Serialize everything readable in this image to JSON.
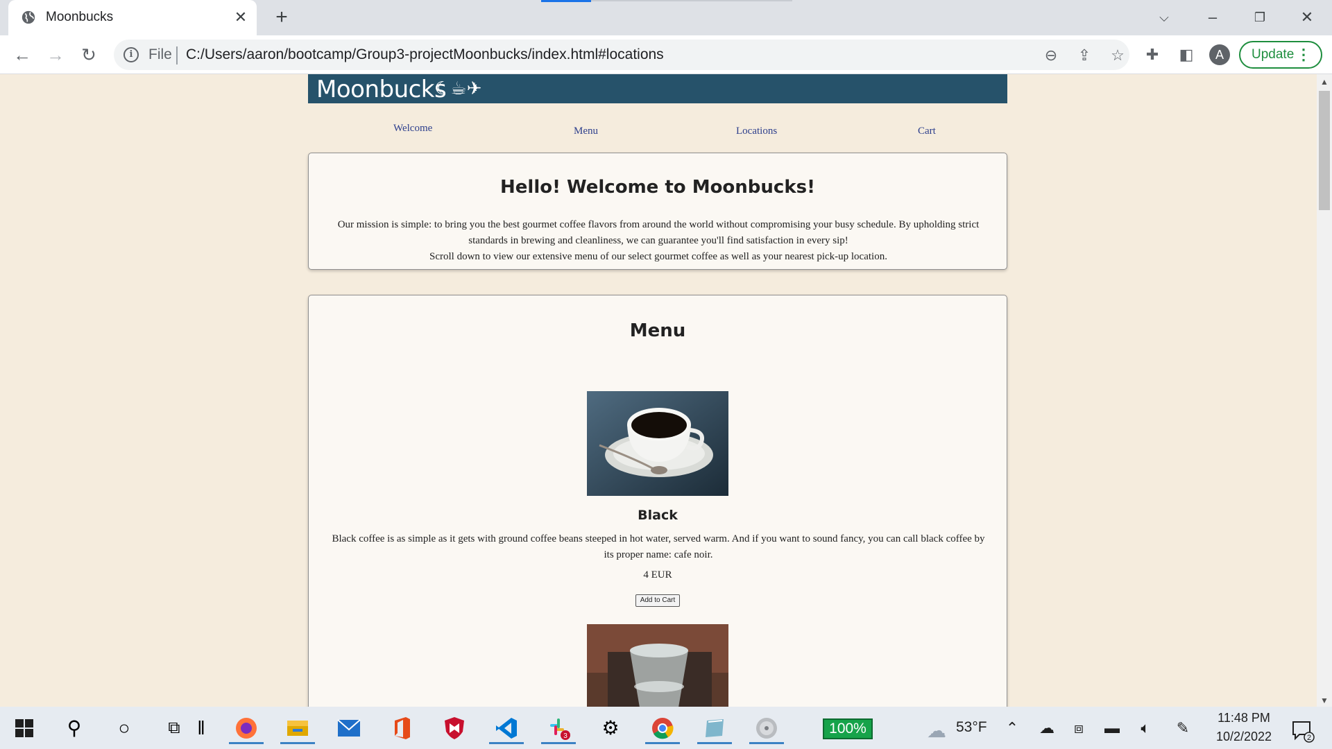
{
  "browser": {
    "tab_title": "Moonbucks",
    "tab_close": "✕",
    "new_tab": "+",
    "url_scheme": "File",
    "url": "C:/Users/aaron/bootcamp/Group3-projectMoonbucks/index.html#locations",
    "avatar_letter": "A",
    "update_label": "Update"
  },
  "site": {
    "title": "Moonbucks",
    "title_icons": "☾☕✈",
    "nav": [
      "Welcome",
      "Menu",
      "Locations",
      "Cart"
    ],
    "welcome": {
      "heading": "Hello! Welcome to Moonbucks!",
      "line1": "Our mission is simple: to bring you the best gourmet coffee flavors from around the world without compromising your busy schedule. By upholding strict standards in brewing and cleanliness, we can guarantee you'll find satisfaction in every sip!",
      "line2": "Scroll down to view our extensive menu of our select gourmet coffee as well as your nearest pick-up location."
    },
    "menu": {
      "heading": "Menu",
      "items": [
        {
          "name": "Black",
          "description": "Black coffee is as simple as it gets with ground coffee beans steeped in hot water, served warm. And if you want to sound fancy, you can call black coffee by its proper name: cafe noir.",
          "price": "4 EUR",
          "button": "Add to Cart"
        }
      ]
    }
  },
  "taskbar": {
    "battery": "100%",
    "temperature": "53°F",
    "slack_badge": "3",
    "notifications_badge": "2",
    "time": "11:48 PM",
    "date": "10/2/2022"
  },
  "colors": {
    "header_bg": "#26526a",
    "page_bg": "#f5ecdd",
    "card_bg": "#fbf8f3",
    "nav_link": "#2c3e8c",
    "update_green": "#1e8e3e"
  }
}
